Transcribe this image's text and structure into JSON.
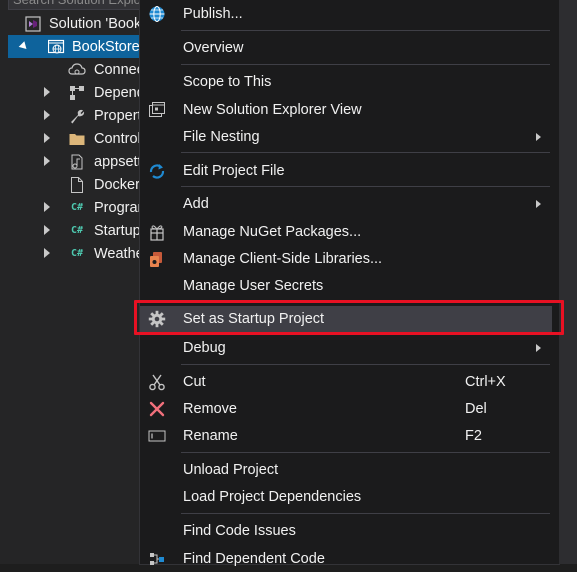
{
  "explorer": {
    "search_placeholder": "Search Solution Explorer",
    "solution_label": "Solution 'BookStore'",
    "project_label": "BookStore",
    "items": [
      {
        "label": "Connected Services"
      },
      {
        "label": "Dependencies"
      },
      {
        "label": "Properties"
      },
      {
        "label": "Controllers"
      },
      {
        "label": "appsettings.json"
      },
      {
        "label": "Dockerfile"
      },
      {
        "label": "Program.cs"
      },
      {
        "label": "Startup.cs"
      },
      {
        "label": "WeatherForecast.cs"
      }
    ]
  },
  "menu": {
    "publish": "Publish...",
    "overview": "Overview",
    "scope_to_this": "Scope to This",
    "new_solution_explorer_view": "New Solution Explorer View",
    "file_nesting": "File Nesting",
    "edit_project_file": "Edit Project File",
    "add": "Add",
    "manage_nuget": "Manage NuGet Packages...",
    "manage_client_libs": "Manage Client-Side Libraries...",
    "manage_user_secrets": "Manage User Secrets",
    "set_startup": "Set as Startup Project",
    "debug": "Debug",
    "cut": "Cut",
    "cut_shortcut": "Ctrl+X",
    "remove": "Remove",
    "remove_shortcut": "Del",
    "rename": "Rename",
    "rename_shortcut": "F2",
    "unload_project": "Unload Project",
    "load_dependencies": "Load Project Dependencies",
    "find_code_issues": "Find Code Issues",
    "find_dependent_code": "Find Dependent Code"
  },
  "colors": {
    "selection": "#0e639c",
    "highlight": "#3f3f46",
    "annotation": "#e81123"
  }
}
